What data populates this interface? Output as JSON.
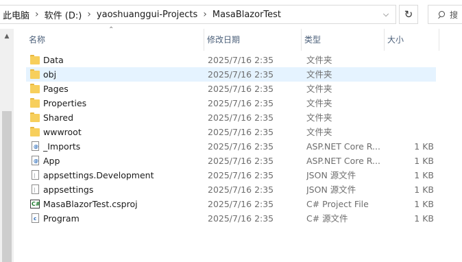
{
  "address": {
    "crumbs": [
      "此电脑",
      "软件 (D:)",
      "yaoshuanggui-Projects",
      "MasaBlazorTest"
    ],
    "separator": "›",
    "dropdown": "⌵"
  },
  "refresh_glyph": "↻",
  "search": {
    "placeholder": "搜"
  },
  "columns": {
    "name": "名称",
    "date": "修改日期",
    "type": "类型",
    "size": "大小"
  },
  "rows": [
    {
      "name": "Data",
      "date": "2025/7/16 2:35",
      "type": "文件夹",
      "size": "",
      "icon": "folder-icon"
    },
    {
      "name": "obj",
      "date": "2025/7/16 2:35",
      "type": "文件夹",
      "size": "",
      "icon": "folder-icon",
      "selected": true
    },
    {
      "name": "Pages",
      "date": "2025/7/16 2:35",
      "type": "文件夹",
      "size": "",
      "icon": "folder-icon"
    },
    {
      "name": "Properties",
      "date": "2025/7/16 2:35",
      "type": "文件夹",
      "size": "",
      "icon": "folder-icon"
    },
    {
      "name": "Shared",
      "date": "2025/7/16 2:35",
      "type": "文件夹",
      "size": "",
      "icon": "folder-icon"
    },
    {
      "name": "wwwroot",
      "date": "2025/7/16 2:35",
      "type": "文件夹",
      "size": "",
      "icon": "folder-icon"
    },
    {
      "name": "_Imports",
      "date": "2025/7/16 2:35",
      "type": "ASP.NET Core R...",
      "size": "1 KB",
      "icon": "razor-file-icon"
    },
    {
      "name": "App",
      "date": "2025/7/16 2:35",
      "type": "ASP.NET Core R...",
      "size": "1 KB",
      "icon": "razor-file-icon"
    },
    {
      "name": "appsettings.Development",
      "date": "2025/7/16 2:35",
      "type": "JSON 源文件",
      "size": "1 KB",
      "icon": "json-file-icon"
    },
    {
      "name": "appsettings",
      "date": "2025/7/16 2:35",
      "type": "JSON 源文件",
      "size": "1 KB",
      "icon": "json-file-icon"
    },
    {
      "name": "MasaBlazorTest.csproj",
      "date": "2025/7/16 2:35",
      "type": "C# Project File",
      "size": "1 KB",
      "icon": "csproj-file-icon"
    },
    {
      "name": "Program",
      "date": "2025/7/16 2:35",
      "type": "C# 源文件",
      "size": "1 KB",
      "icon": "csharp-file-icon"
    }
  ]
}
